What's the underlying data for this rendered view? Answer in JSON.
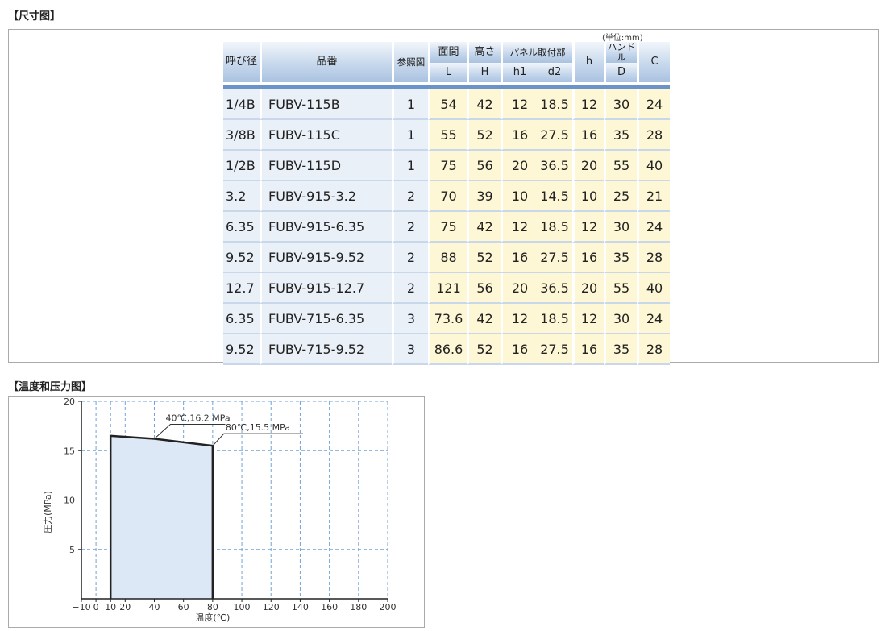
{
  "section1": {
    "title": "【尺寸图】",
    "unit": "(単位:mm)"
  },
  "table": {
    "headers": {
      "size": "呼び径",
      "part": "品番",
      "ref": "参照図",
      "L_top": "面間",
      "L_bot": "L",
      "H_top": "高さ",
      "H_bot": "H",
      "panel_top": "パネル取付部",
      "h1": "h1",
      "d2": "d2",
      "h": "h",
      "D_top": "ハンドル",
      "D_bot": "D",
      "C": "C"
    },
    "rows": [
      {
        "size": "1/4B",
        "part": "FUBV-115B",
        "ref": "1",
        "L": "54",
        "H": "42",
        "h1": "12",
        "d2": "18.5",
        "h": "12",
        "D": "30",
        "C": "24"
      },
      {
        "size": "3/8B",
        "part": "FUBV-115C",
        "ref": "1",
        "L": "55",
        "H": "52",
        "h1": "16",
        "d2": "27.5",
        "h": "16",
        "D": "35",
        "C": "28"
      },
      {
        "size": "1/2B",
        "part": "FUBV-115D",
        "ref": "1",
        "L": "75",
        "H": "56",
        "h1": "20",
        "d2": "36.5",
        "h": "20",
        "D": "55",
        "C": "40"
      },
      {
        "size": "3.2",
        "part": "FUBV-915-3.2",
        "ref": "2",
        "L": "70",
        "H": "39",
        "h1": "10",
        "d2": "14.5",
        "h": "10",
        "D": "25",
        "C": "21"
      },
      {
        "size": "6.35",
        "part": "FUBV-915-6.35",
        "ref": "2",
        "L": "75",
        "H": "42",
        "h1": "12",
        "d2": "18.5",
        "h": "12",
        "D": "30",
        "C": "24"
      },
      {
        "size": "9.52",
        "part": "FUBV-915-9.52",
        "ref": "2",
        "L": "88",
        "H": "52",
        "h1": "16",
        "d2": "27.5",
        "h": "16",
        "D": "35",
        "C": "28"
      },
      {
        "size": "12.7",
        "part": "FUBV-915-12.7",
        "ref": "2",
        "L": "121",
        "H": "56",
        "h1": "20",
        "d2": "36.5",
        "h": "20",
        "D": "55",
        "C": "40"
      },
      {
        "size": "6.35",
        "part": "FUBV-715-6.35",
        "ref": "3",
        "L": "73.6",
        "H": "42",
        "h1": "12",
        "d2": "18.5",
        "h": "12",
        "D": "30",
        "C": "24"
      },
      {
        "size": "9.52",
        "part": "FUBV-715-9.52",
        "ref": "3",
        "L": "86.6",
        "H": "52",
        "h1": "16",
        "d2": "27.5",
        "h": "16",
        "D": "35",
        "C": "28"
      }
    ]
  },
  "section2": {
    "title": "【温度和压力图】"
  },
  "chart_data": {
    "type": "area",
    "xlabel": "温度(℃)",
    "ylabel": "圧力(MPa)",
    "xlim": [
      -10,
      200
    ],
    "ylim": [
      0,
      20
    ],
    "x_ticks": [
      -10,
      0,
      10,
      20,
      40,
      60,
      80,
      100,
      120,
      140,
      160,
      180,
      200
    ],
    "y_ticks": [
      5,
      10,
      15,
      20
    ],
    "grid": true,
    "series": [
      {
        "x": [
          10,
          10,
          40,
          80,
          80
        ],
        "y": [
          0,
          16.5,
          16.2,
          15.5,
          0
        ]
      }
    ],
    "annotations": [
      {
        "text": "40℃,16.2 MPa",
        "x": 40,
        "y": 16.2
      },
      {
        "text": "80℃,15.5 MPa",
        "x": 80,
        "y": 15.5
      }
    ],
    "colors": {
      "fill": "#dde8f6",
      "line": "#222222",
      "grid": "#6fa3d6"
    }
  }
}
